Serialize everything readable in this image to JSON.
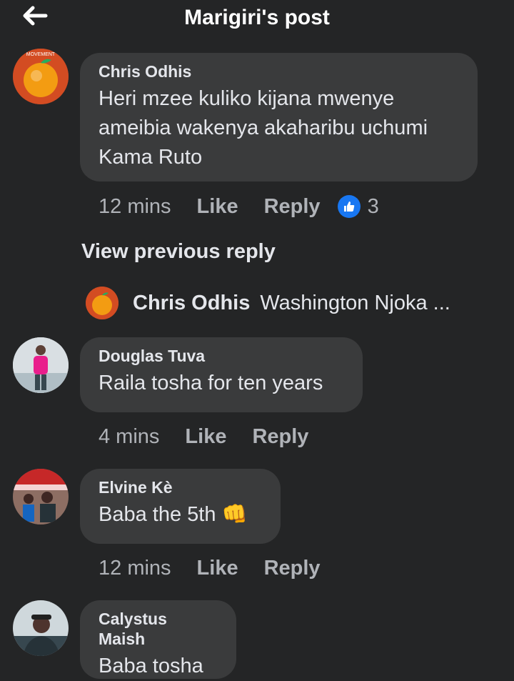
{
  "header": {
    "title": "Marigiri's post",
    "back_icon": "arrow-left-icon"
  },
  "comments": [
    {
      "author": "Chris Odhis",
      "text": "Heri mzee kuliko kijana mwenye ameibia wakenya akaharibu uchumi Kama Ruto",
      "time": "12 mins",
      "like_label": "Like",
      "reply_label": "Reply",
      "reaction_icon": "thumbs-up-icon",
      "reaction_count": "3",
      "avatar_caption": "MOVEMENT"
    },
    {
      "author": "Douglas Tuva",
      "text": "Raila tosha for ten years",
      "time": "4 mins",
      "like_label": "Like",
      "reply_label": "Reply"
    },
    {
      "author": "Elvine Kè",
      "text": "Baba the 5th 👊",
      "time": "12 mins",
      "like_label": "Like",
      "reply_label": "Reply"
    },
    {
      "author": "Calystus Maish",
      "text": "Baba tosha"
    }
  ],
  "view_previous": "View previous reply",
  "reply_preview": {
    "name": "Chris Odhis",
    "text": "Washington Njoka ..."
  },
  "colors": {
    "background": "#242526",
    "bubble": "#3a3b3c",
    "text": "#e4e6eb",
    "secondary": "#b0b3b8",
    "reaction_blue": "#1877f2"
  }
}
